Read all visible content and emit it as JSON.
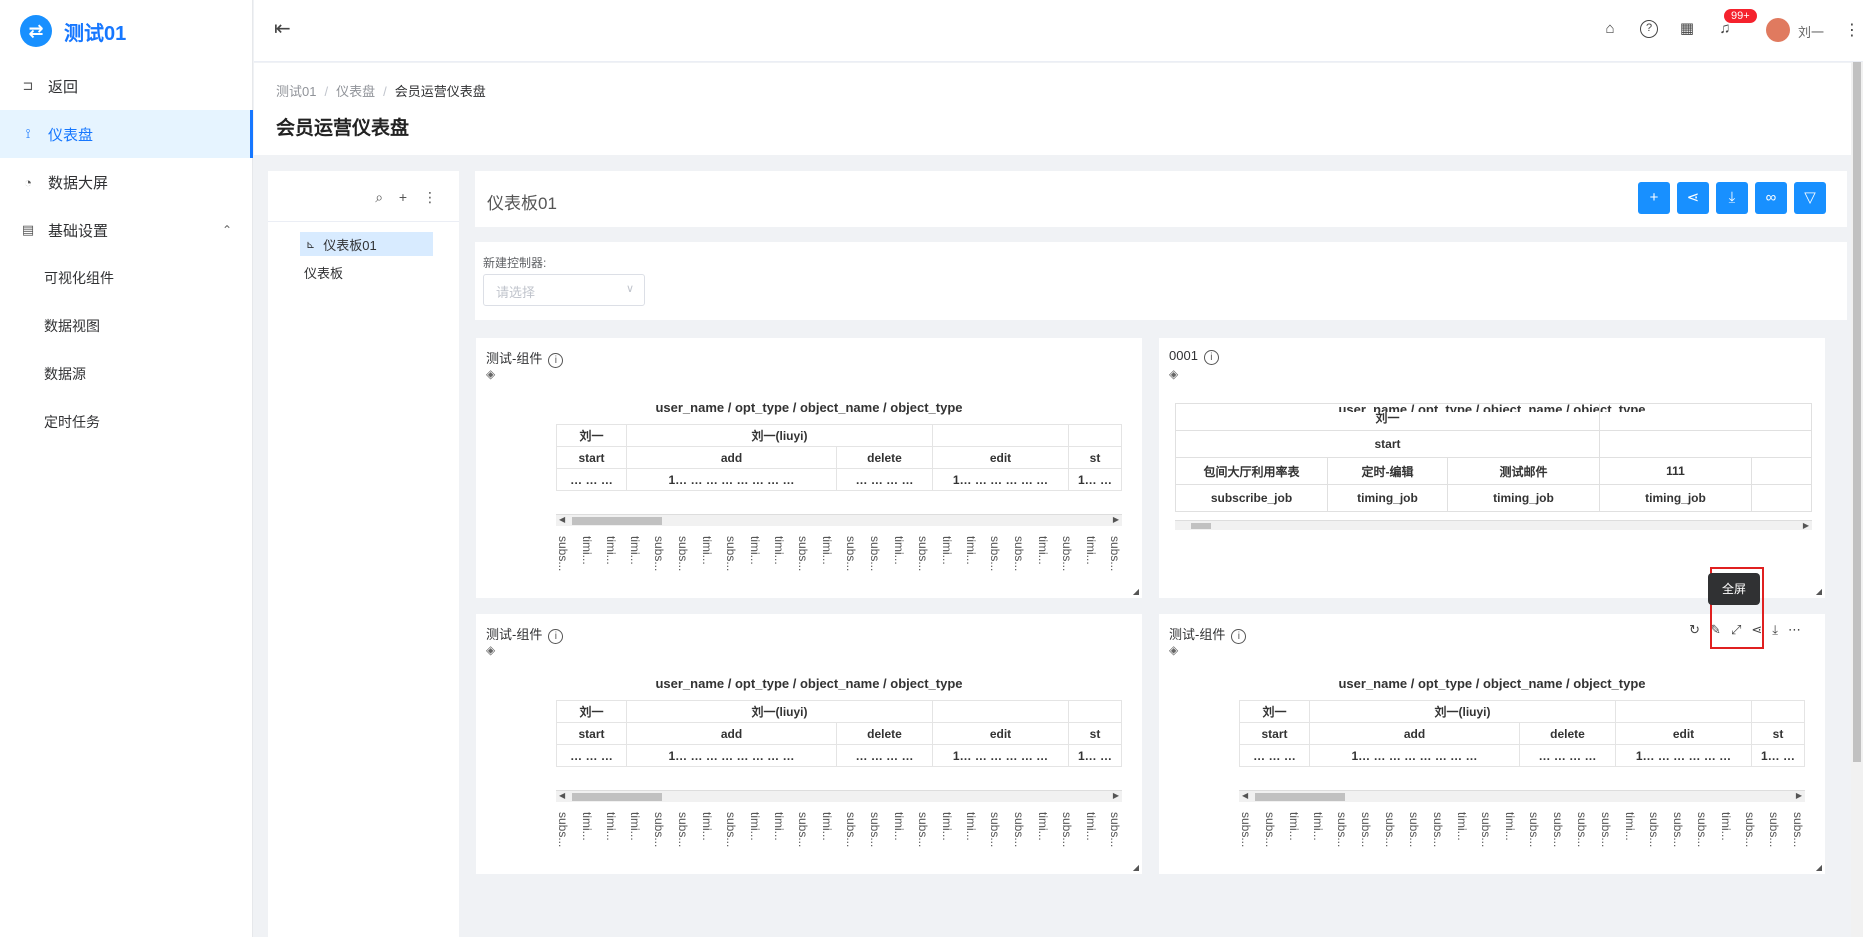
{
  "app": {
    "logo_glyph": "⇄",
    "title": "测试01"
  },
  "sidebar": {
    "items": [
      {
        "icon": "return-icon",
        "label": "返回"
      },
      {
        "icon": "dashboard-icon",
        "label": "仪表盘"
      },
      {
        "icon": "screen-icon",
        "label": "数据大屏"
      },
      {
        "icon": "settings-icon",
        "label": "基础设置"
      }
    ],
    "subitems": [
      "可视化组件",
      "数据视图",
      "数据源",
      "定时任务"
    ]
  },
  "header": {
    "badge": "99+",
    "user": "刘一"
  },
  "breadcrumb": [
    "测试01",
    "仪表盘",
    "会员运营仪表盘"
  ],
  "page_title": "会员运营仪表盘",
  "tree": {
    "nodes": [
      "仪表板01",
      "仪表板"
    ]
  },
  "dashboard": {
    "title": "仪表板01",
    "controller_label": "新建控制器:",
    "controller_placeholder": "请选择"
  },
  "panels": [
    {
      "title": "测试-组件",
      "header": "user_name / opt_type / object_name / object_type",
      "r1a": "刘一",
      "r1b": "刘一(liuyi)",
      "r2": [
        "start",
        "add",
        "delete",
        "edit",
        "st"
      ],
      "foot": "subs..."
    },
    {
      "title": "0001",
      "header": "user_name / opt_type / object_name / object_type",
      "row1": "刘一",
      "row2": "start",
      "row3": [
        "包间大厅利用率表",
        "定时-编辑",
        "测试邮件",
        "111"
      ],
      "row4": [
        "subscribe_job",
        "timing_job",
        "timing_job",
        "timing_job"
      ]
    },
    {
      "title": "测试-组件",
      "header": "user_name / opt_type / object_name / object_type"
    },
    {
      "title": "测试-组件",
      "header": "user_name / opt_type / object_name / object_type"
    }
  ],
  "tooltip": "全屏",
  "colors": {
    "accent": "#1890ff",
    "badge": "#f5222d",
    "highlight": "#e02020"
  }
}
